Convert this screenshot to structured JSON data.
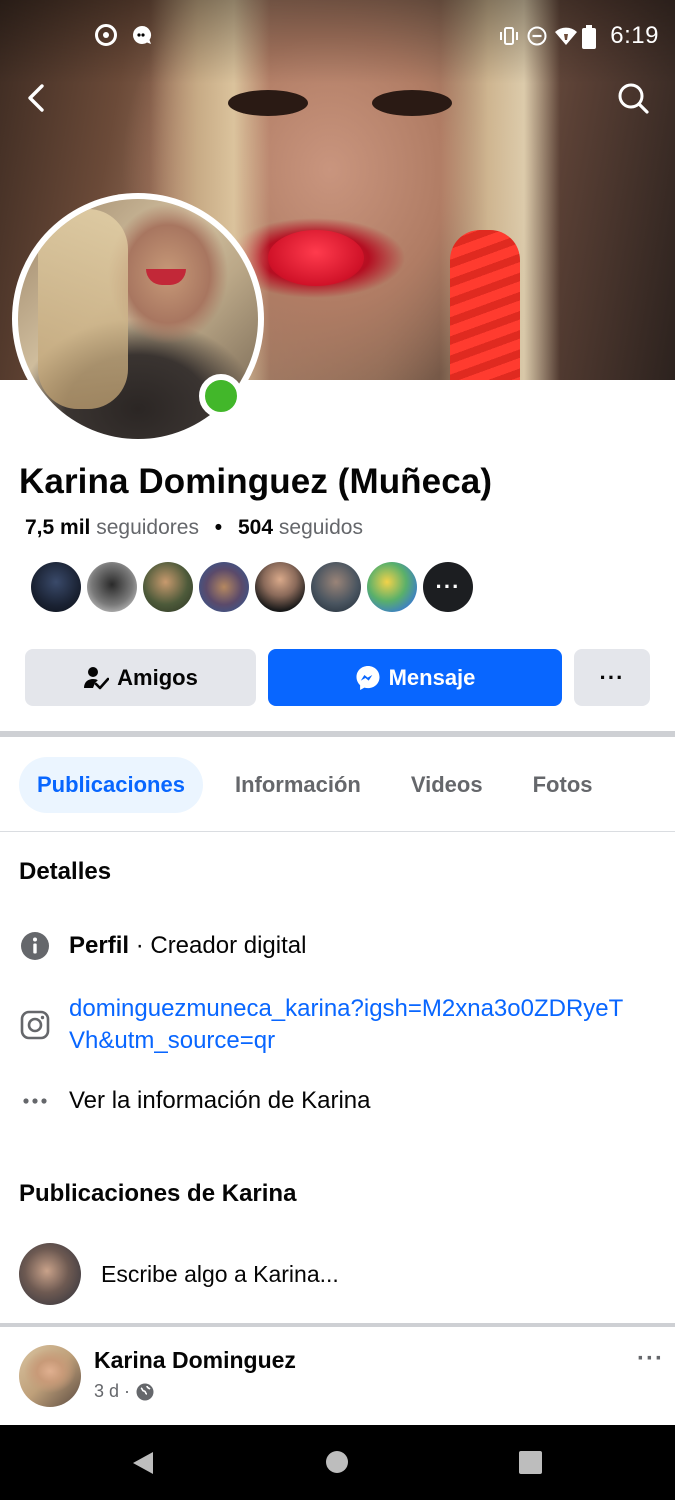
{
  "status_bar": {
    "time": "6:19",
    "left_icons": [
      "screen-record-icon",
      "chat-bubble-icon"
    ],
    "right_icons": [
      "vibrate-icon",
      "do-not-disturb-icon",
      "wifi-icon",
      "battery-icon"
    ]
  },
  "header": {
    "back_icon": "chevron-left-icon",
    "search_icon": "search-icon"
  },
  "profile": {
    "name": "Karina Dominguez (Muñeca)",
    "followers_count": "7,5 mil",
    "followers_label": "seguidores",
    "separator": "•",
    "following_count": "504",
    "following_label": "seguidos",
    "online": true,
    "mutual_friends_more": "···"
  },
  "actions": {
    "friends_label": "Amigos",
    "message_label": "Mensaje",
    "more_label": "···"
  },
  "tabs": [
    {
      "label": "Publicaciones",
      "active": true
    },
    {
      "label": "Información",
      "active": false
    },
    {
      "label": "Videos",
      "active": false
    },
    {
      "label": "Fotos",
      "active": false
    }
  ],
  "details": {
    "title": "Detalles",
    "profile_label": "Perfil",
    "profile_value": " · Creador digital",
    "instagram_link": "dominguezmuneca_karina?igsh=M2xna3o0ZDRyeTVh&utm_source=qr",
    "more_info": "Ver la información de Karina"
  },
  "posts": {
    "title": "Publicaciones de Karina",
    "composer_prompt": "Escribe algo a Karina...",
    "post_author": "Karina Dominguez",
    "post_time": "3 d ·",
    "post_more": "···"
  },
  "colors": {
    "accent": "#0866ff",
    "online": "#42b72a",
    "button_gray": "#e4e6eb",
    "tab_active_bg": "#ebf5ff",
    "secondary_text": "#65676b"
  }
}
